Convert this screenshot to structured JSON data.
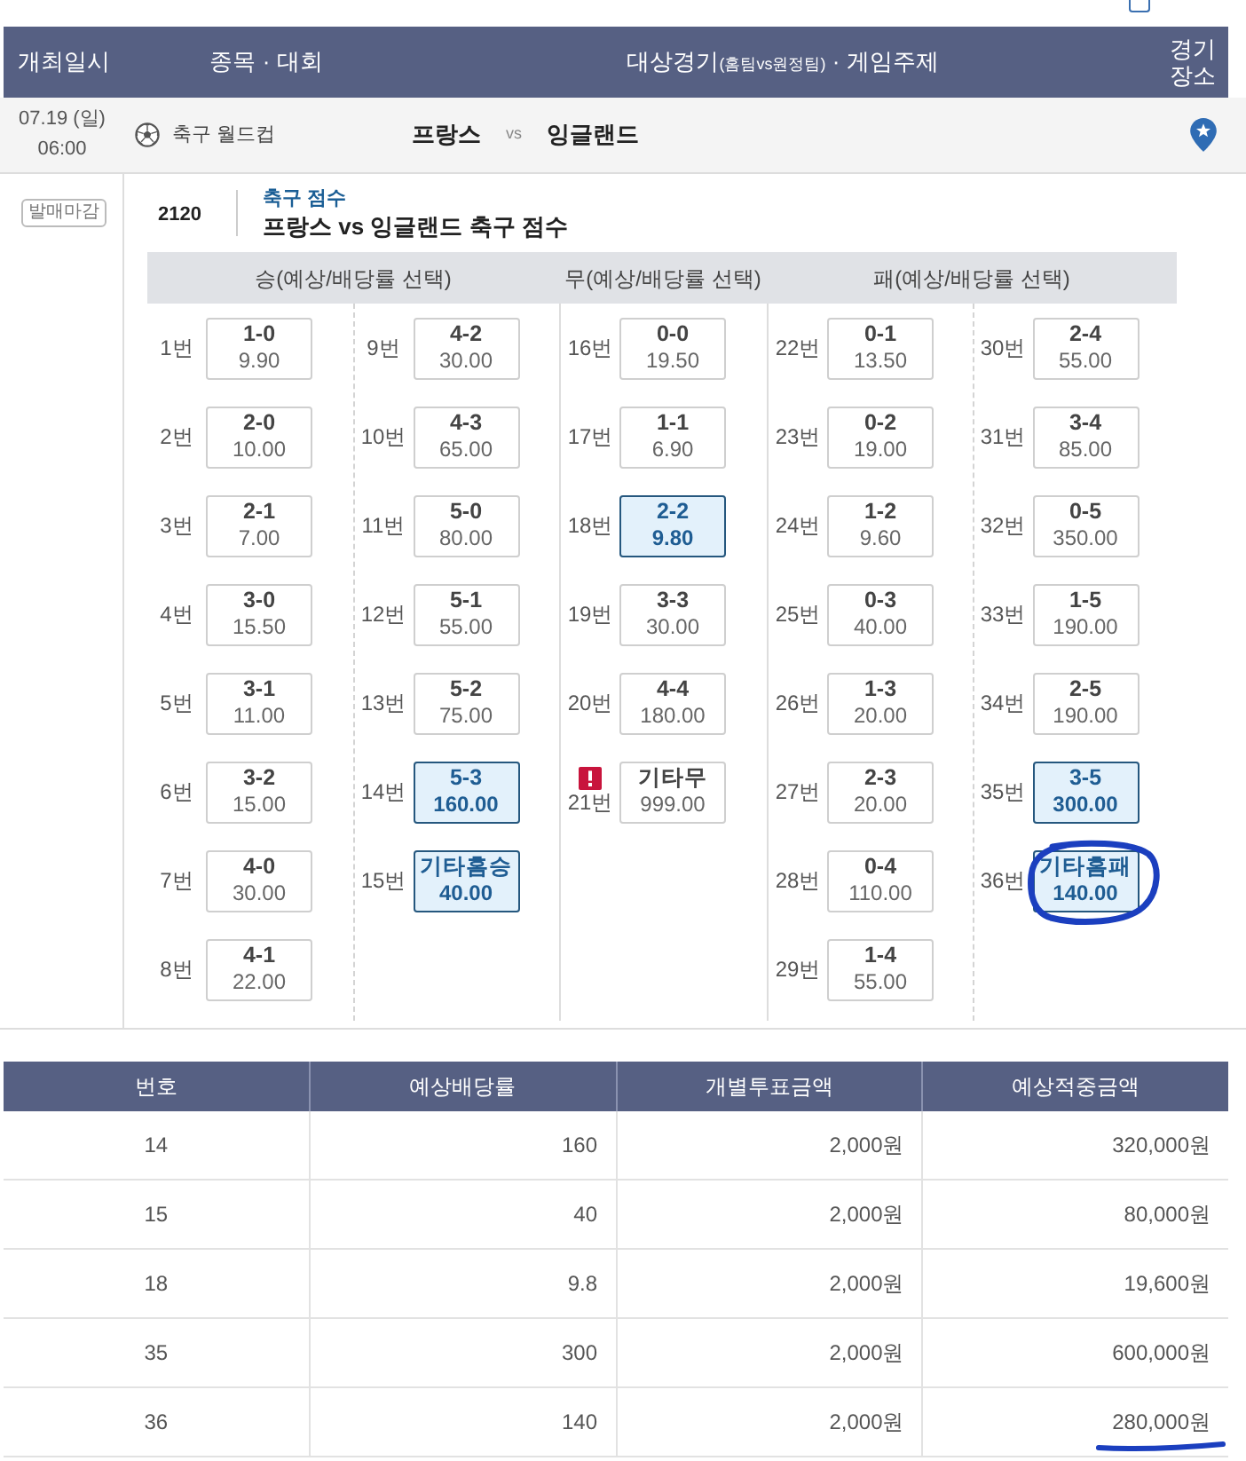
{
  "top_checkbox": {
    "checked": false
  },
  "header": {
    "columns": [
      {
        "label": "개최일시"
      },
      {
        "label": "종목 · 대회"
      },
      {
        "label": "대상경기",
        "note": "(홈팀vs원정팀)",
        "suffix": " · 게임주제"
      },
      {
        "label": "경기 장소"
      }
    ]
  },
  "match": {
    "date": "07.19 (일)",
    "time": "06:00",
    "sport": "축구 월드컵",
    "home": "프랑스",
    "vs": "vs",
    "away": "잉글랜드"
  },
  "status_badge": "발매마감",
  "game": {
    "number": "2120",
    "category": "축구 점수",
    "title": "프랑스 vs 잉글랜드 축구 점수"
  },
  "bet_grid": {
    "groups": [
      {
        "title": "승(예상/배당률 선택)",
        "columns": [
          [
            {
              "no": "1번",
              "score": "1-0",
              "odds": "9.90",
              "selected": false,
              "alert": false,
              "circled": false
            },
            {
              "no": "2번",
              "score": "2-0",
              "odds": "10.00",
              "selected": false,
              "alert": false,
              "circled": false
            },
            {
              "no": "3번",
              "score": "2-1",
              "odds": "7.00",
              "selected": false,
              "alert": false,
              "circled": false
            },
            {
              "no": "4번",
              "score": "3-0",
              "odds": "15.50",
              "selected": false,
              "alert": false,
              "circled": false
            },
            {
              "no": "5번",
              "score": "3-1",
              "odds": "11.00",
              "selected": false,
              "alert": false,
              "circled": false
            },
            {
              "no": "6번",
              "score": "3-2",
              "odds": "15.00",
              "selected": false,
              "alert": false,
              "circled": false
            },
            {
              "no": "7번",
              "score": "4-0",
              "odds": "30.00",
              "selected": false,
              "alert": false,
              "circled": false
            },
            {
              "no": "8번",
              "score": "4-1",
              "odds": "22.00",
              "selected": false,
              "alert": false,
              "circled": false
            }
          ],
          [
            {
              "no": "9번",
              "score": "4-2",
              "odds": "30.00",
              "selected": false,
              "alert": false,
              "circled": false
            },
            {
              "no": "10번",
              "score": "4-3",
              "odds": "65.00",
              "selected": false,
              "alert": false,
              "circled": false
            },
            {
              "no": "11번",
              "score": "5-0",
              "odds": "80.00",
              "selected": false,
              "alert": false,
              "circled": false
            },
            {
              "no": "12번",
              "score": "5-1",
              "odds": "55.00",
              "selected": false,
              "alert": false,
              "circled": false
            },
            {
              "no": "13번",
              "score": "5-2",
              "odds": "75.00",
              "selected": false,
              "alert": false,
              "circled": false
            },
            {
              "no": "14번",
              "score": "5-3",
              "odds": "160.00",
              "selected": true,
              "alert": false,
              "circled": false
            },
            {
              "no": "15번",
              "score": "기타홈승",
              "odds": "40.00",
              "selected": true,
              "alert": false,
              "circled": false
            }
          ]
        ]
      },
      {
        "title": "무(예상/배당률 선택)",
        "columns": [
          [
            {
              "no": "16번",
              "score": "0-0",
              "odds": "19.50",
              "selected": false,
              "alert": false,
              "circled": false
            },
            {
              "no": "17번",
              "score": "1-1",
              "odds": "6.90",
              "selected": false,
              "alert": false,
              "circled": false
            },
            {
              "no": "18번",
              "score": "2-2",
              "odds": "9.80",
              "selected": true,
              "alert": false,
              "circled": false
            },
            {
              "no": "19번",
              "score": "3-3",
              "odds": "30.00",
              "selected": false,
              "alert": false,
              "circled": false
            },
            {
              "no": "20번",
              "score": "4-4",
              "odds": "180.00",
              "selected": false,
              "alert": false,
              "circled": false
            },
            {
              "no": "21번",
              "score": "기타무",
              "odds": "999.00",
              "selected": false,
              "alert": true,
              "circled": false
            }
          ]
        ]
      },
      {
        "title": "패(예상/배당률 선택)",
        "columns": [
          [
            {
              "no": "22번",
              "score": "0-1",
              "odds": "13.50",
              "selected": false,
              "alert": false,
              "circled": false
            },
            {
              "no": "23번",
              "score": "0-2",
              "odds": "19.00",
              "selected": false,
              "alert": false,
              "circled": false
            },
            {
              "no": "24번",
              "score": "1-2",
              "odds": "9.60",
              "selected": false,
              "alert": false,
              "circled": false
            },
            {
              "no": "25번",
              "score": "0-3",
              "odds": "40.00",
              "selected": false,
              "alert": false,
              "circled": false
            },
            {
              "no": "26번",
              "score": "1-3",
              "odds": "20.00",
              "selected": false,
              "alert": false,
              "circled": false
            },
            {
              "no": "27번",
              "score": "2-3",
              "odds": "20.00",
              "selected": false,
              "alert": false,
              "circled": false
            },
            {
              "no": "28번",
              "score": "0-4",
              "odds": "110.00",
              "selected": false,
              "alert": false,
              "circled": false
            },
            {
              "no": "29번",
              "score": "1-4",
              "odds": "55.00",
              "selected": false,
              "alert": false,
              "circled": false
            }
          ],
          [
            {
              "no": "30번",
              "score": "2-4",
              "odds": "55.00",
              "selected": false,
              "alert": false,
              "circled": false
            },
            {
              "no": "31번",
              "score": "3-4",
              "odds": "85.00",
              "selected": false,
              "alert": false,
              "circled": false
            },
            {
              "no": "32번",
              "score": "0-5",
              "odds": "350.00",
              "selected": false,
              "alert": false,
              "circled": false
            },
            {
              "no": "33번",
              "score": "1-5",
              "odds": "190.00",
              "selected": false,
              "alert": false,
              "circled": false
            },
            {
              "no": "34번",
              "score": "2-5",
              "odds": "190.00",
              "selected": false,
              "alert": false,
              "circled": false
            },
            {
              "no": "35번",
              "score": "3-5",
              "odds": "300.00",
              "selected": true,
              "alert": false,
              "circled": false
            },
            {
              "no": "36번",
              "score": "기타홈패",
              "odds": "140.00",
              "selected": true,
              "alert": false,
              "circled": true
            }
          ]
        ]
      }
    ]
  },
  "summary_table": {
    "columns": [
      "번호",
      "예상배당률",
      "개별투표금액",
      "예상적중금액"
    ],
    "rows": [
      {
        "cells": [
          "14",
          "160",
          "2,000원",
          "320,000원"
        ],
        "underlined": false
      },
      {
        "cells": [
          "15",
          "40",
          "2,000원",
          "80,000원"
        ],
        "underlined": false
      },
      {
        "cells": [
          "18",
          "9.8",
          "2,000원",
          "19,600원"
        ],
        "underlined": false
      },
      {
        "cells": [
          "35",
          "300",
          "2,000원",
          "600,000원"
        ],
        "underlined": false
      },
      {
        "cells": [
          "36",
          "140",
          "2,000원",
          "280,000원"
        ],
        "underlined": true
      }
    ]
  }
}
